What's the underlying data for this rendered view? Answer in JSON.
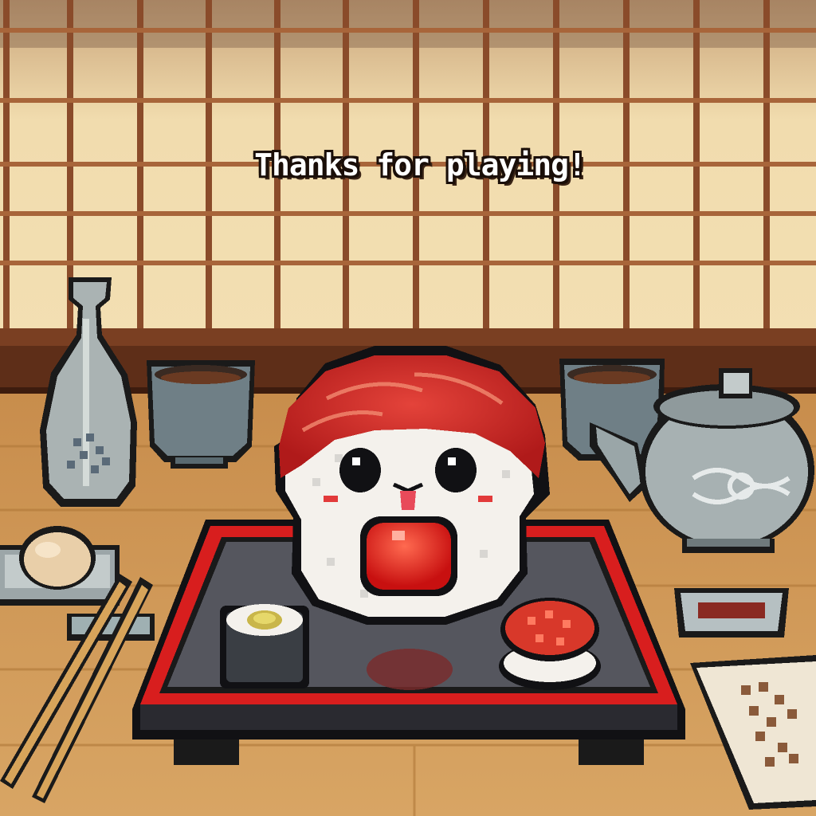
{
  "screen": {
    "message": "Thanks for playing!"
  },
  "palette": {
    "wall": "#f0d9a8",
    "frame": "#8a4b2a",
    "table": "#d9a35c",
    "tray_rim": "#d81e1e",
    "tray_base": "#2a2a30",
    "tuna": "#d8282a",
    "rice": "#f4f1ec",
    "ceramic": "#8f9a9c"
  },
  "icons": [
    "sake-bottle-icon",
    "tea-cup-icon",
    "teapot-icon",
    "sushi-character-icon",
    "maki-roll-icon",
    "salmon-roe-nigiri-icon",
    "chopsticks-icon",
    "soy-sauce-dish-icon",
    "onigiri-icon",
    "menu-card-icon"
  ]
}
